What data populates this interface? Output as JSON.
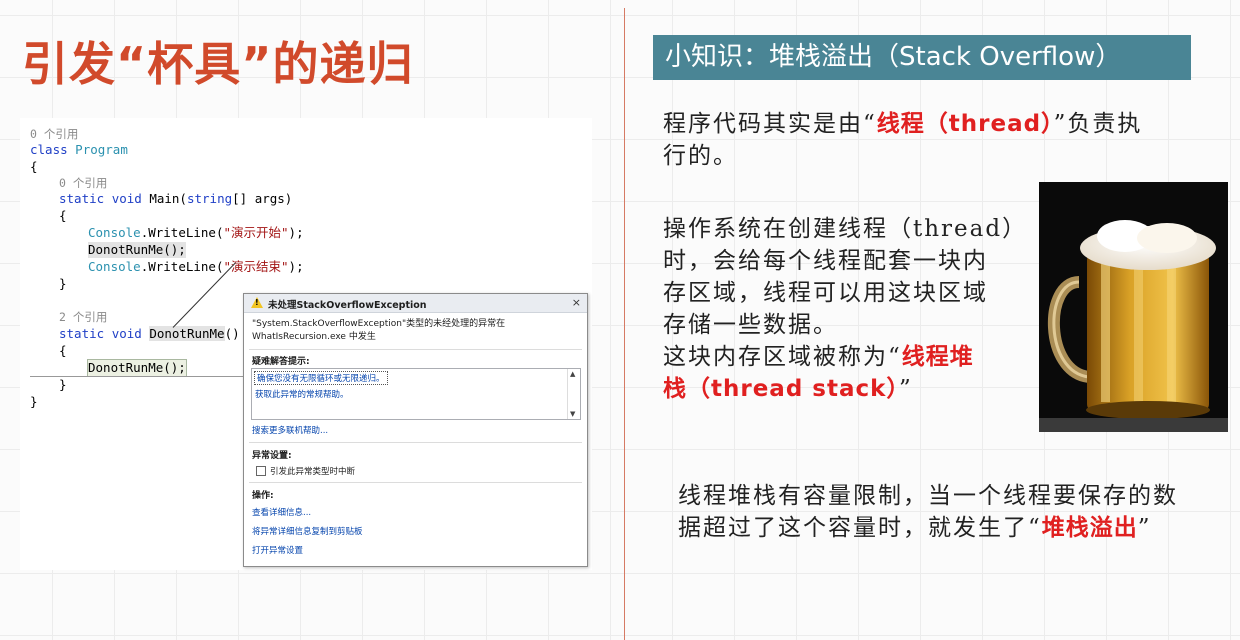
{
  "slide": {
    "title": "引发“杯具”的递归"
  },
  "code": {
    "ref0": "0 个引用",
    "class_kw": "class",
    "class_name": "Program",
    "brace_open": "{",
    "brace_close": "}",
    "ref_main": "0 个引用",
    "main_static": "static",
    "main_void": "void",
    "main_name": "Main(",
    "main_string": "string",
    "main_args": "[] args)",
    "main_brace_open": "{",
    "console1_type": "Console",
    "console1_call": ".WriteLine(",
    "console1_str": "\"演示开始\"",
    "console1_end": ");",
    "donot_call": "DonotRunMe();",
    "console2_type": "Console",
    "console2_call": ".WriteLine(",
    "console2_str": "\"演示结束\"",
    "console2_end": ");",
    "main_brace_close": "}",
    "ref_donot": "2 个引用",
    "donot_static": "static",
    "donot_void": "void",
    "donot_name": "DonotRunMe",
    "donot_parens": "()",
    "donot_brace_open": "{",
    "recursive_call": "DonotRunMe();",
    "donot_brace_close": "}",
    "class_brace_close": "}"
  },
  "exception": {
    "title": "未处理StackOverflowException",
    "close": "×",
    "message_line1": "\"System.StackOverflowException\"类型的未经处理的异常在",
    "message_line2": "WhatIsRecursion.exe 中发生",
    "tips_label": "疑难解答提示:",
    "tip1": "确保您没有无限循环或无限递归。",
    "tip2": "获取此异常的常规帮助。",
    "search_more": "搜索更多联机帮助...",
    "settings_label": "异常设置:",
    "settings_checkbox": "引发此异常类型时中断",
    "actions_label": "操作:",
    "action1": "查看详细信息...",
    "action2": "将异常详细信息复制到剪贴板",
    "action3": "打开异常设置"
  },
  "knowledge": {
    "banner": "小知识：堆栈溢出（Stack Overflow）",
    "p1_a": "程序代码其实是由“",
    "p1_red": "线程（thread）",
    "p1_b": "”负责执",
    "p1_c": "行的。",
    "p2_l1": "操作系统在创建线程（thread）",
    "p2_l2": "时，会给每个线程配套一块内",
    "p2_l3": "存区域，线程可以用这块区域",
    "p2_l4": "存储一些数据。",
    "p2_l5a": "这块内存区域被称为“",
    "p2_l5red": "线程堆",
    "p2_l6red": "栈（thread stack）",
    "p2_l6b": "”",
    "p3_l1": "线程堆栈有容量限制，当一个线程要保存的数",
    "p3_l2a": "据超过了这个容量时，就发生了“",
    "p3_l2red": "堆栈溢出",
    "p3_l2b": "”"
  },
  "colors": {
    "title": "#d14a2b",
    "banner": "#4a8595",
    "highlight_red": "#e02020",
    "divider": "#d67a64"
  }
}
